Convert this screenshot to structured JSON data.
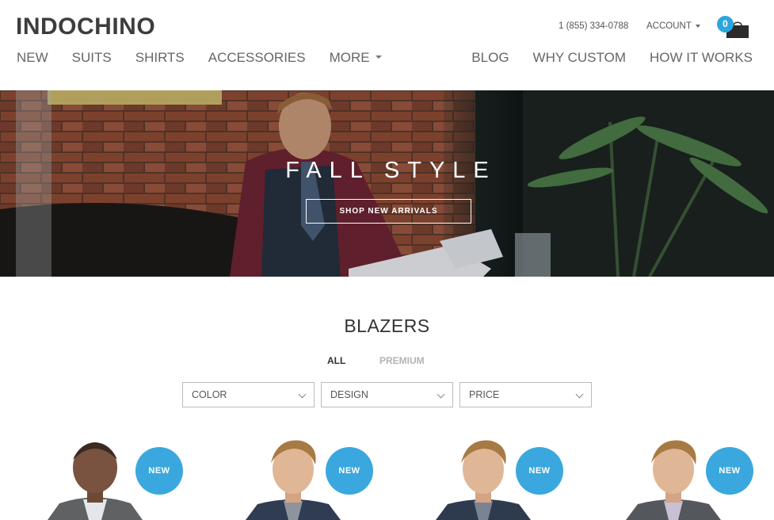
{
  "header": {
    "logo": "INDOCHINO",
    "phone": "1 (855) 334-0788",
    "account_label": "ACCOUNT",
    "cart_count": "0"
  },
  "nav": {
    "left": [
      "NEW",
      "SUITS",
      "SHIRTS",
      "ACCESSORIES",
      "MORE"
    ],
    "right": [
      "BLOG",
      "WHY CUSTOM",
      "HOW IT WORKS"
    ]
  },
  "hero": {
    "title": "FALL STYLE",
    "button": "SHOP NEW ARRIVALS"
  },
  "section": {
    "title": "BLAZERS",
    "tabs": [
      "ALL",
      "PREMIUM"
    ],
    "filters": [
      "COLOR",
      "DESIGN",
      "PRICE"
    ]
  },
  "products": [
    {
      "badge": "NEW"
    },
    {
      "badge": "NEW"
    },
    {
      "badge": "NEW"
    },
    {
      "badge": "NEW"
    }
  ],
  "colors": {
    "accent": "#2ba6e1",
    "badge": "#3aa8de",
    "nav_text": "#666666",
    "inactive_tab": "#b3b3b3"
  }
}
